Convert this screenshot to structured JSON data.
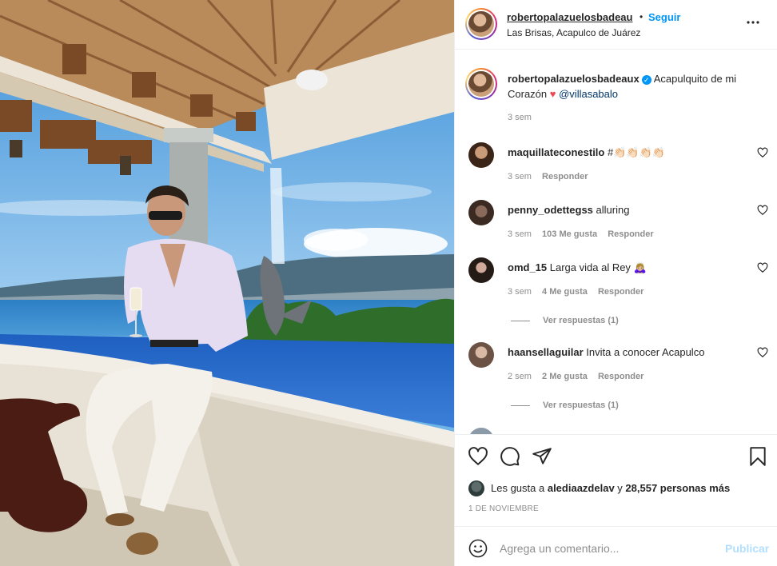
{
  "post": {
    "username": "robertopalazuelosbadeau",
    "separator": "•",
    "follow_label": "Seguir",
    "location": "Las Brisas, Acapulco de Juárez",
    "more_icon": "more-horizontal-icon"
  },
  "caption": {
    "username": "robertopalazuelosbadeaux",
    "text": "Acapulquito de mi Corazón",
    "heart": "♥",
    "mention": "@villasabalo",
    "time": "3 sem"
  },
  "comments": [
    {
      "username": "maquillateconestilo",
      "text": "#👏🏻👏🏻👏🏻👏🏻",
      "time": "3 sem",
      "likes": "",
      "reply_label": "Responder",
      "replies": ""
    },
    {
      "username": "penny_odettegss",
      "text": "alluring",
      "time": "3 sem",
      "likes": "103 Me gusta",
      "reply_label": "Responder",
      "replies": ""
    },
    {
      "username": "omd_15",
      "text": "Larga vida al Rey 🙇🏼‍♀️",
      "time": "3 sem",
      "likes": "4 Me gusta",
      "reply_label": "Responder",
      "replies": "Ver respuestas (1)"
    },
    {
      "username": "haansellaguilar",
      "text": "Invita a conocer Acapulco",
      "time": "2 sem",
      "likes": "2 Me gusta",
      "reply_label": "Responder",
      "replies": "Ver respuestas (1)"
    }
  ],
  "likes": {
    "prefix": "Les gusta a",
    "user": "alediaazdelav",
    "connector": "y",
    "count": "28,557 personas más"
  },
  "date": "1 DE NOVIEMBRE",
  "add_comment": {
    "emoji_icon": "emoji-smile-icon",
    "placeholder": "Agrega un comentario...",
    "post_label": "Publicar"
  },
  "icons": [
    "heart-icon",
    "comment-icon",
    "share-icon",
    "bookmark-icon"
  ],
  "colors": {
    "accent": "#0095f6",
    "muted": "#8e8e8e",
    "heart": "#ed4956",
    "post_disabled": "#b2dffc"
  }
}
